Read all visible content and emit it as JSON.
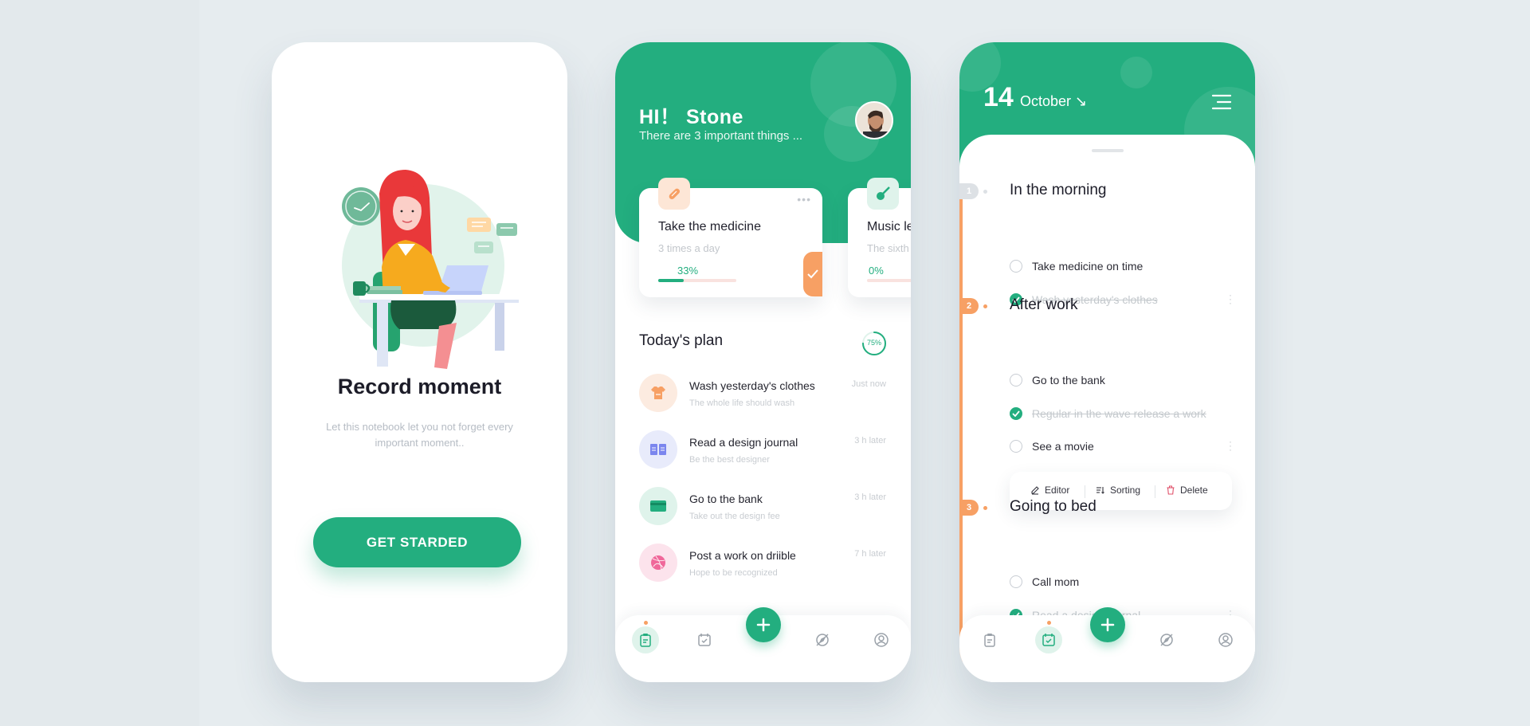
{
  "onboarding": {
    "title": "Record moment",
    "subtitle": "Let this notebook let you not forget every important moment..",
    "cta_label": "GET STARDED"
  },
  "home": {
    "greeting": "HI！ Stone",
    "subtitle": "There are 3 important things ...",
    "cards": [
      {
        "title": "Take the medicine",
        "subtitle": "3 times a day",
        "progress_label": "33%",
        "progress": 0.33,
        "icon": "pill-icon"
      },
      {
        "title": "Music le",
        "subtitle": "The sixth",
        "progress_label": "0%",
        "progress": 0,
        "icon": "guitar-icon"
      }
    ],
    "plan_title": "Today's plan",
    "plan_progress_label": "75%",
    "plan_progress": 0.75,
    "plan_items": [
      {
        "title": "Wash yesterday's clothes",
        "subtitle": "The whole life should wash",
        "time": "Just now",
        "icon": "shirt-icon",
        "color": "#fcebe0"
      },
      {
        "title": "Read a design journal",
        "subtitle": "Be the best designer",
        "time": "3 h later",
        "icon": "book-icon",
        "color": "#e8ebfb"
      },
      {
        "title": "Go to the bank",
        "subtitle": "Take out the design fee",
        "time": "3 h later",
        "icon": "card-icon",
        "color": "#dff3eb"
      },
      {
        "title": "Post a work on driible",
        "subtitle": "Hope to be recognized",
        "time": "7 h later",
        "icon": "dribbble-icon",
        "color": "#fce3ec"
      }
    ]
  },
  "calendar": {
    "day": "14",
    "month": "October ↘",
    "sections": [
      {
        "num": "1",
        "title": "In the morning",
        "items": [
          {
            "label": "Take medicine on time",
            "done": false
          },
          {
            "label": "Wash yesterday's clothes",
            "done": true
          }
        ]
      },
      {
        "num": "2",
        "title": "After work",
        "items": [
          {
            "label": "Go to the bank",
            "done": false
          },
          {
            "label": "Regular in the wave release a work",
            "done": true
          },
          {
            "label": "See a movie",
            "done": false
          }
        ]
      },
      {
        "num": "3",
        "title": "Going to bed",
        "items": [
          {
            "label": "Call mom",
            "done": false
          },
          {
            "label": "Read a design journal",
            "done": true
          }
        ]
      }
    ],
    "menu": {
      "editor": "Editor",
      "sorting": "Sorting",
      "delete": "Delete"
    }
  },
  "colors": {
    "primary": "#23ae7f",
    "accent": "#f7a064",
    "background": "#e6ecef"
  }
}
